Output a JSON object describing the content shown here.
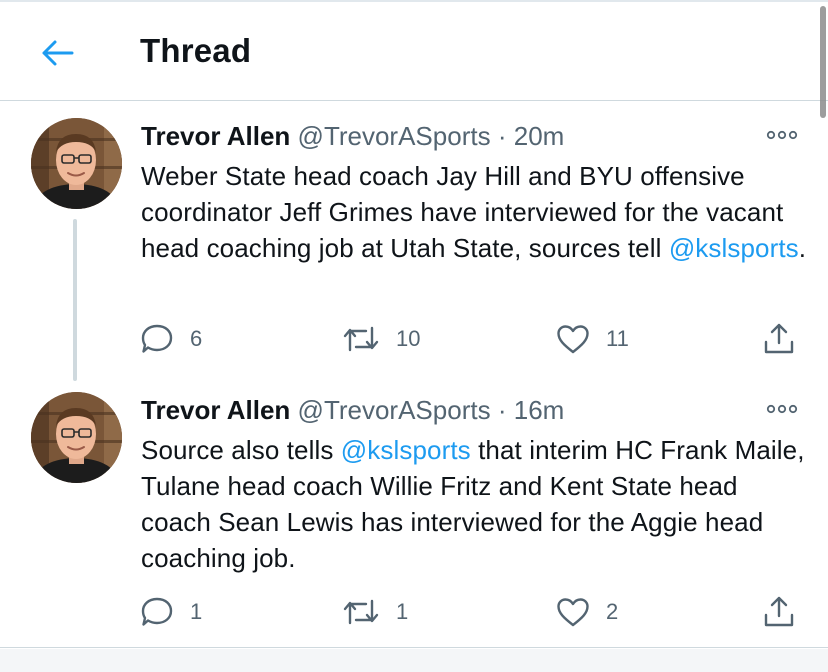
{
  "header": {
    "title": "Thread",
    "back_icon": "arrow-left-icon"
  },
  "colors": {
    "accent": "#1d9bf0",
    "text_primary": "#0f1419",
    "text_secondary": "#536471",
    "divider": "#cfd9de"
  },
  "tweets": [
    {
      "author": "Trevor Allen",
      "handle": "@TrevorASports",
      "separator": "·",
      "time": "20m",
      "text_parts": {
        "a": "Weber State head coach Jay Hill and BYU offensive coordinator Jeff Grimes have interviewed for the vacant head coaching job at Utah State, sources tell ",
        "mention": "@kslsports",
        "b": "."
      },
      "replies": "6",
      "retweets": "10",
      "likes": "11"
    },
    {
      "author": "Trevor Allen",
      "handle": "@TrevorASports",
      "separator": "·",
      "time": "16m",
      "text_parts": {
        "a": "Source also tells ",
        "mention": "@kslsports",
        "b": " that interim HC Frank Maile, Tulane head coach Willie Fritz and Kent State head coach Sean Lewis has interviewed for the Aggie head coaching job."
      },
      "replies": "1",
      "retweets": "1",
      "likes": "2"
    }
  ],
  "icons": {
    "reply": "reply-icon",
    "retweet": "retweet-icon",
    "like": "heart-icon",
    "share": "share-icon",
    "more": "more-icon"
  }
}
